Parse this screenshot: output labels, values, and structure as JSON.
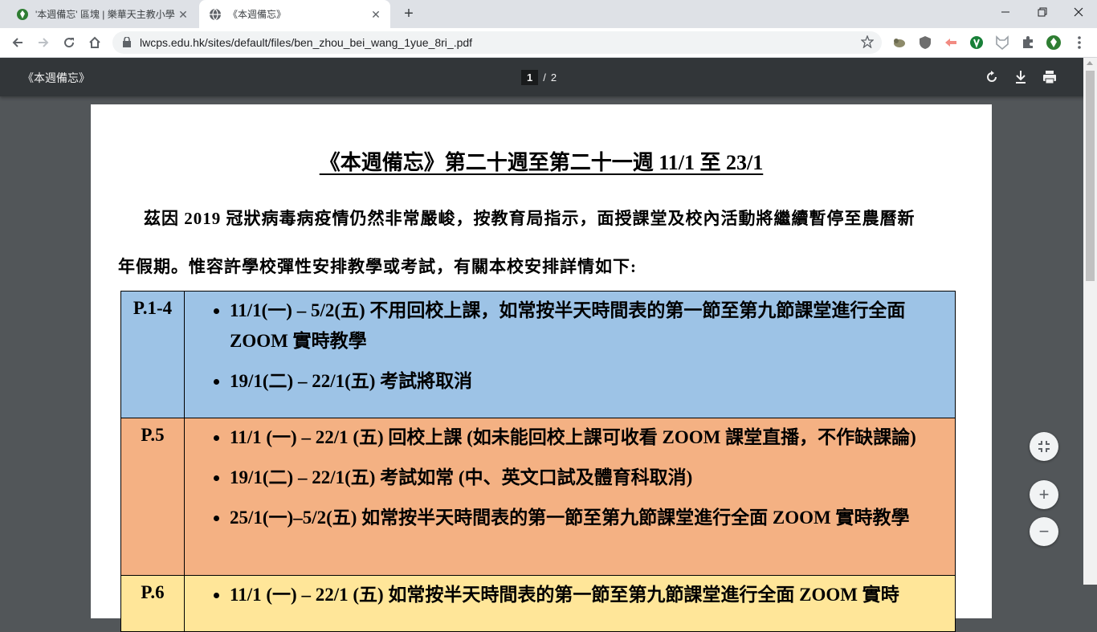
{
  "browser": {
    "tabs": [
      {
        "title": "'本週備忘' 區塊 | 樂華天主教小學",
        "active": false
      },
      {
        "title": "《本週備忘》",
        "active": true
      }
    ],
    "new_tab": "+",
    "url": "lwcps.edu.hk/sites/default/files/ben_zhou_bei_wang_1yue_8ri_.pdf"
  },
  "pdf_toolbar": {
    "title": "《本週備忘》",
    "current_page": "1",
    "separator": "/",
    "total_pages": "2"
  },
  "document": {
    "heading": "《本週備忘》第二十週至第二十一週 11/1 至 23/1",
    "para_line1": "茲因 2019 冠狀病毒病疫情仍然非常嚴峻，按教育局指示，面授課堂及校內活動將繼續暫停至農曆新",
    "para_line2": "年假期。惟容許學校彈性安排教學或考試，有關本校安排詳情如下:",
    "rows": [
      {
        "grade": "P.1-4",
        "items": [
          "11/1(一) – 5/2(五) 不用回校上課，如常按半天時間表的第一節至第九節課堂進行全面 ZOOM 實時教學",
          "19/1(二) – 22/1(五) 考試將取消"
        ]
      },
      {
        "grade": "P.5",
        "items": [
          "11/1 (一) – 22/1 (五) 回校上課 (如未能回校上課可收看 ZOOM 課堂直播，不作缺課論)",
          "19/1(二) – 22/1(五) 考試如常 (中、英文口試及體育科取消)",
          "25/1(一)–5/2(五) 如常按半天時間表的第一節至第九節課堂進行全面 ZOOM 實時教學"
        ]
      },
      {
        "grade": "P.6",
        "items": [
          "11/1 (一) – 22/1 (五) 如常按半天時間表的第一節至第九節課堂進行全面 ZOOM 實時"
        ]
      }
    ]
  },
  "zoom_controls": {
    "plus": "+",
    "minus": "−"
  },
  "colors": {
    "row1": "#9dc3e6",
    "row2": "#f4b183",
    "row3": "#ffe699",
    "pdf_toolbar": "#323639"
  }
}
